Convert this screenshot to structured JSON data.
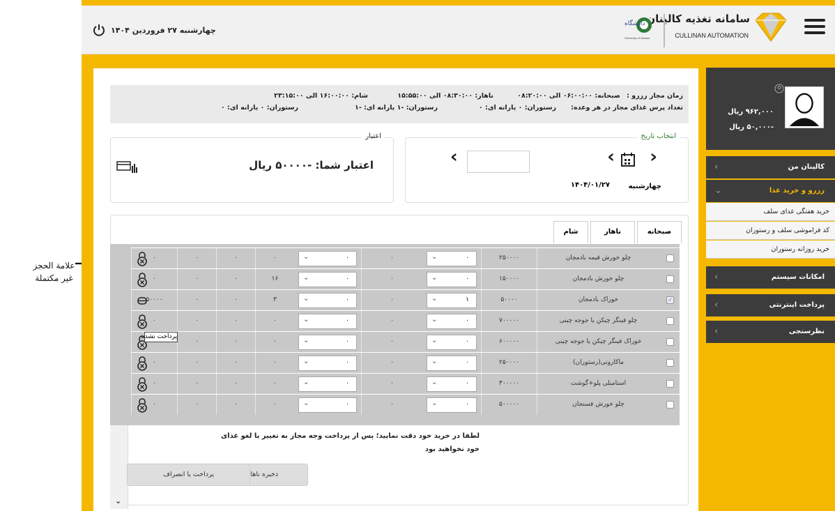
{
  "header": {
    "app_title": "سامانه تغذیه کالینان",
    "app_subtitle": "CULLINAN AUTOMATION",
    "university_logo_text": "University of Isfahan",
    "date": "چهارشنبه ۲۷ فروردین ۱۴۰۴"
  },
  "sidebar": {
    "balances": [
      "۹۶۲,۰۰۰ ریال",
      "-۵۰,۰۰۰ ریال"
    ],
    "items": [
      {
        "label": "کالینان من",
        "active": false
      },
      {
        "label": "رزرو و خرید غذا",
        "active": true
      },
      {
        "label": "امکانات سیستم",
        "active": false
      },
      {
        "label": "پرداخت اینترنتی",
        "active": false
      },
      {
        "label": "نظرسنجی",
        "active": false
      }
    ],
    "sub_items": [
      "خرید هفتگی غذای سلف",
      "کد فراموشی سلف و رستوران",
      "خرید روزانه رستوران"
    ]
  },
  "info": {
    "line1_label": "زمان مجاز رزرو :",
    "breakfast": "صبحانه: ۰۶:۰۰:۰۰ الی ۰۸:۲۰:۰۰",
    "lunch": "ناهار: ۰۸:۳۰:۰۰ الی ۱۵:۵۵:۰۰",
    "dinner": "شام: ۱۶:۰۰:۰۰ الی ۲۳:۱۵:۰۰",
    "line2_label": "تعداد پرس غذای مجاز در هر وعده:",
    "q1": "رستوران: ۰   یارانه ای: ۰",
    "q2": "رستوران: -۱   یارانه ای: -۱",
    "q3": "رستوران: ۰   یارانه ای: ۰"
  },
  "date_box": {
    "legend": "انتخاب تاریخ",
    "day": "چهارشنبه",
    "date": "۱۴۰۴/۰۱/۲۷"
  },
  "credit_box": {
    "legend": "اعتبار",
    "text": "اعتبار شما: -۵۰۰۰۰ ریال"
  },
  "tabs": [
    {
      "label": "صبحانه",
      "active": false
    },
    {
      "label": "ناهار",
      "active": true
    },
    {
      "label": "شام",
      "active": false
    }
  ],
  "rows": [
    {
      "name": "چلو خورش قیمه بادمجان",
      "price": "۲۵۰۰۰۰",
      "qty": "۰",
      "c1": "۰",
      "qty2": "۰",
      "c3": "۰",
      "c4": "۰",
      "c5": "۰",
      "checked": false,
      "status": "locked"
    },
    {
      "name": "چلو خورش بادمجان",
      "price": "۱۵۰۰۰۰",
      "qty": "۰",
      "c1": "۰",
      "qty2": "۰",
      "c3": "۱۶",
      "c4": "۰",
      "c5": "۰",
      "checked": false,
      "status": "locked"
    },
    {
      "name": "خوراک بادمجان",
      "price": "۵۰۰۰۰",
      "qty": "۱",
      "c1": "۰",
      "qty2": "۰",
      "c3": "۳",
      "c4": "۰",
      "c5": "۵۰۰۰۰",
      "checked": true,
      "status": "unpaid"
    },
    {
      "name": "چلو فینگر چیکن یا جوجه چینی",
      "price": "۷۰۰۰۰۰",
      "qty": "۰",
      "c1": "۰",
      "qty2": "۰",
      "c3": "۰",
      "c4": "۰",
      "c5": "۰",
      "checked": false,
      "status": "locked"
    },
    {
      "name": "خوراک فینگر چیکن یا جوجه چینی",
      "price": "۶۰۰۰۰۰",
      "qty": "۰",
      "c1": "۰",
      "qty2": "۰",
      "c3": "۰",
      "c4": "۰",
      "c5": "۰",
      "checked": false,
      "status": "locked"
    },
    {
      "name": "ماکارونی(رستوران)",
      "price": "۲۵۰۰۰۰",
      "qty": "۰",
      "c1": "۰",
      "qty2": "۰",
      "c3": "۰",
      "c4": "۰",
      "c5": "۰",
      "checked": false,
      "status": "locked"
    },
    {
      "name": "استامبلی پلو+گوشت",
      "price": "۳۰۰۰۰۰",
      "qty": "۰",
      "c1": "۰",
      "qty2": "۰",
      "c3": "۰",
      "c4": "۰",
      "c5": "۰",
      "checked": false,
      "status": "locked"
    },
    {
      "name": "چلو خورش فسنجان",
      "price": "۵۰۰۰۰۰",
      "qty": "۰",
      "c1": "۰",
      "qty2": "۰",
      "c3": "۰",
      "c4": "۰",
      "c5": "۰",
      "checked": false,
      "status": "locked"
    }
  ],
  "tooltip": "پرداخت نشده",
  "warning": "لطفا در خرید خود دقت نمایید؛ پس از پرداخت وجه مجاز به تغییر یا لغو غذای خود نخواهید بود",
  "buttons": {
    "save": "ذخیره ناهار",
    "pay": "پرداخت یا انصراف"
  },
  "annotation": "علامة الحجز غير مكتملة",
  "colors": {
    "accent": "#f5b800",
    "dark": "#3c3c3c"
  }
}
